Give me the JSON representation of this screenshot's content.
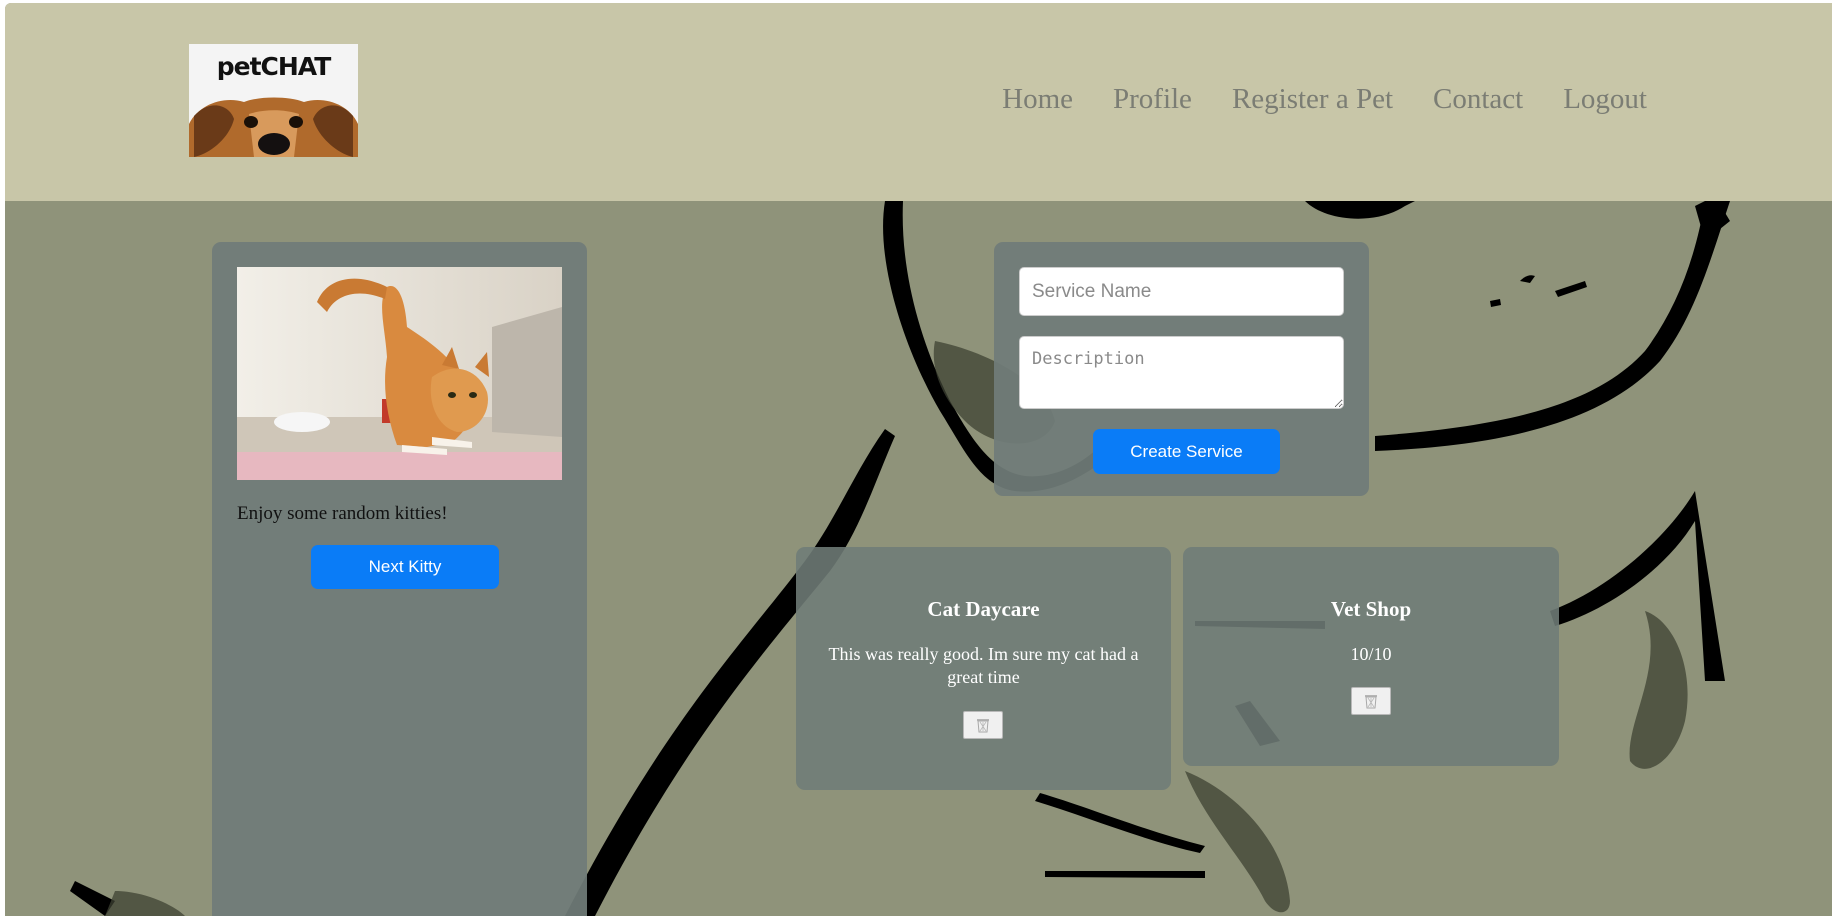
{
  "header": {
    "logo_text": "petCHAT",
    "nav": [
      {
        "label": "Home"
      },
      {
        "label": "Profile"
      },
      {
        "label": "Register a Pet"
      },
      {
        "label": "Contact"
      },
      {
        "label": "Logout"
      }
    ]
  },
  "kitty": {
    "caption": "Enjoy some random kitties!",
    "next_label": "Next Kitty"
  },
  "service_form": {
    "name_placeholder": "Service Name",
    "description_placeholder": "Description",
    "create_label": "Create Service"
  },
  "services": [
    {
      "title": "Cat Daycare",
      "description": "This was really good. Im sure my cat had a great time",
      "delete_icon": "trash-icon"
    },
    {
      "title": "Vet Shop",
      "description": "10/10",
      "delete_icon": "trash-icon"
    }
  ],
  "colors": {
    "header_bg": "#c8c6a8",
    "page_bg": "#8f937a",
    "panel_bg": "#707c78",
    "button": "#0a7cf7",
    "nav_text": "#7b7d74"
  }
}
